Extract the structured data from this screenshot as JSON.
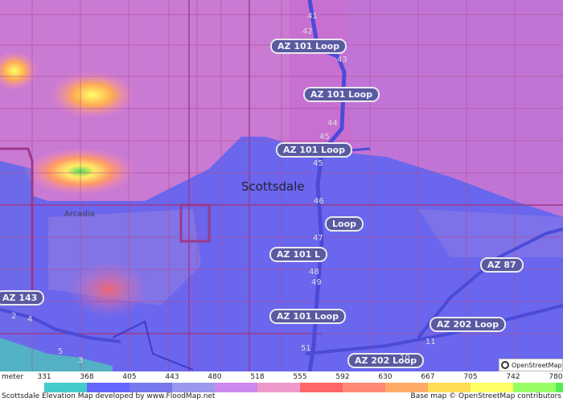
{
  "map": {
    "city_label": "Scottsdale",
    "place_labels": [
      "Arcadia"
    ],
    "highway_shields": [
      "AZ 101 Loop",
      "AZ 101 Loop",
      "AZ 101 Loop",
      "Loop",
      "AZ 101 L",
      "AZ 101 Loop",
      "AZ 87",
      "AZ 202 Loop",
      "AZ 202 Loop",
      "AZ 143"
    ],
    "exit_numbers": [
      "41",
      "42",
      "43",
      "44",
      "45",
      "45",
      "46",
      "47",
      "48",
      "49",
      "51",
      "11",
      "10",
      "2",
      "4",
      "5",
      "3"
    ],
    "attribution_logo": "OpenStreetMap"
  },
  "legend": {
    "unit": "meter",
    "ticks": [
      "331",
      "368",
      "405",
      "443",
      "480",
      "518",
      "555",
      "592",
      "630",
      "667",
      "705",
      "742",
      "780"
    ],
    "colors": [
      "#44cccc",
      "#6666ff",
      "#7777ee",
      "#9999ee",
      "#cc88ee",
      "#ee99cc",
      "#ff6666",
      "#ff8877",
      "#ffaa66",
      "#ffdd55",
      "#ffff66",
      "#99ff66",
      "#55ee55"
    ]
  },
  "footer": {
    "left": "Scottsdale Elevation Map developed by www.FloodMap.net",
    "right": "Base map © OpenStreetMap contributors"
  }
}
